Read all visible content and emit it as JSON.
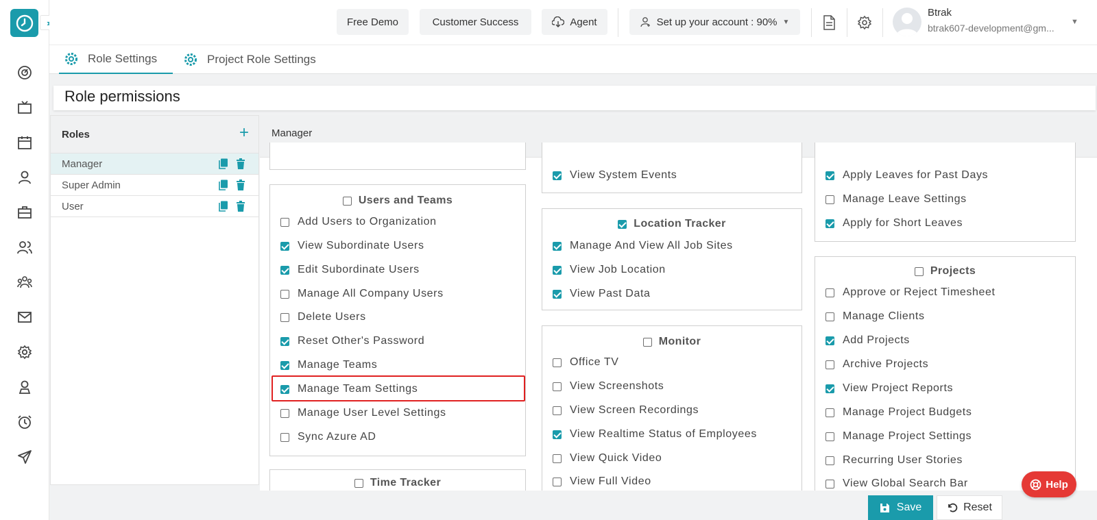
{
  "header": {
    "buttons": {
      "free_demo": "Free Demo",
      "customer_success": "Customer Success",
      "agent": "Agent",
      "setup": "Set up your account : 90%"
    },
    "user": {
      "name": "Btrak",
      "email": "btrak607-development@gm..."
    }
  },
  "tabs": [
    {
      "label": "Role Settings",
      "active": true
    },
    {
      "label": "Project Role Settings",
      "active": false
    }
  ],
  "page_title": "Role permissions",
  "roles_panel": {
    "title": "Roles",
    "items": [
      {
        "name": "Manager",
        "selected": true
      },
      {
        "name": "Super Admin",
        "selected": false
      },
      {
        "name": "User",
        "selected": false
      }
    ]
  },
  "selected_role_value": "Manager",
  "permissions": {
    "col1": {
      "users_teams": {
        "title": "Users and Teams",
        "checked": false,
        "items": [
          {
            "label": "Add Users to Organization",
            "checked": false
          },
          {
            "label": "View Subordinate Users",
            "checked": true
          },
          {
            "label": "Edit Subordinate Users",
            "checked": true
          },
          {
            "label": "Manage All Company Users",
            "checked": false
          },
          {
            "label": "Delete Users",
            "checked": false
          },
          {
            "label": "Reset Other's Password",
            "checked": true
          },
          {
            "label": "Manage Teams",
            "checked": true
          },
          {
            "label": "Manage Team Settings",
            "checked": true
          },
          {
            "label": "Manage User Level Settings",
            "checked": false
          },
          {
            "label": "Sync Azure AD",
            "checked": false
          }
        ]
      },
      "time_tracker": {
        "title": "Time Tracker",
        "checked": false
      }
    },
    "col2": {
      "top_items": [
        {
          "label": "View System Events",
          "checked": true
        }
      ],
      "location_tracker": {
        "title": "Location Tracker",
        "checked": true,
        "items": [
          {
            "label": "Manage And View All Job Sites",
            "checked": true
          },
          {
            "label": "View Job Location",
            "checked": true
          },
          {
            "label": "View Past Data",
            "checked": true
          }
        ]
      },
      "monitor": {
        "title": "Monitor",
        "checked": false,
        "items": [
          {
            "label": "Office TV",
            "checked": false
          },
          {
            "label": "View Screenshots",
            "checked": false
          },
          {
            "label": "View Screen Recordings",
            "checked": false
          },
          {
            "label": "View Realtime Status of Employees",
            "checked": true
          },
          {
            "label": "View Quick Video",
            "checked": false
          },
          {
            "label": "View Full Video",
            "checked": false
          }
        ]
      }
    },
    "col3": {
      "top_items": [
        {
          "label": "Apply Leaves for Past Days",
          "checked": true
        },
        {
          "label": "Manage Leave Settings",
          "checked": false
        },
        {
          "label": "Apply for Short Leaves",
          "checked": true
        }
      ],
      "projects": {
        "title": "Projects",
        "checked": false,
        "items": [
          {
            "label": "Approve or Reject Timesheet",
            "checked": false
          },
          {
            "label": "Manage Clients",
            "checked": false
          },
          {
            "label": "Add Projects",
            "checked": true
          },
          {
            "label": "Archive Projects",
            "checked": false
          },
          {
            "label": "View Project Reports",
            "checked": true
          },
          {
            "label": "Manage Project Budgets",
            "checked": false
          },
          {
            "label": "Manage Project Settings",
            "checked": false
          },
          {
            "label": "Recurring User Stories",
            "checked": false
          },
          {
            "label": "View Global Search Bar",
            "checked": false
          }
        ]
      }
    }
  },
  "actions": {
    "save": "Save",
    "reset": "Reset"
  },
  "help": "Help",
  "colors": {
    "accent": "#1a9bab",
    "highlight": "#e02020",
    "help": "#e53935"
  }
}
